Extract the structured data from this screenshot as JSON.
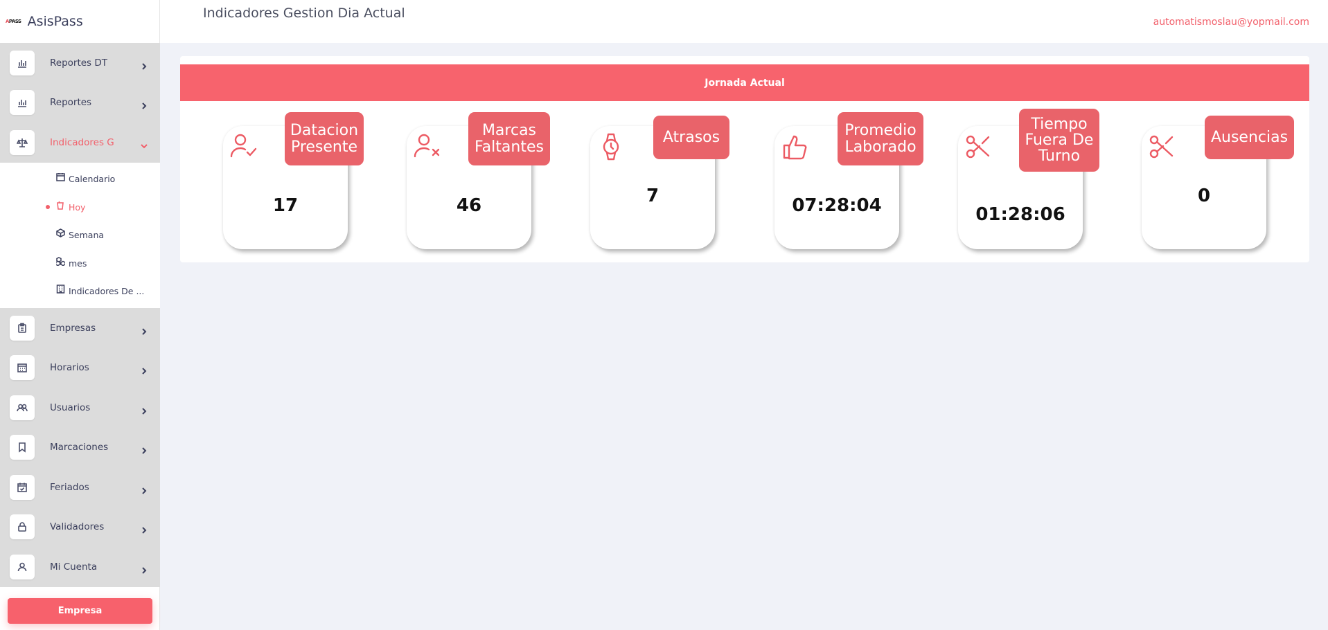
{
  "brand": {
    "logo_text": "AsisPass",
    "name": "AsisPass"
  },
  "header": {
    "title": "Indicadores Gestion Dia Actual",
    "user_email": "automatismoslau@yopmail.com"
  },
  "sidebar": {
    "items_top": [
      {
        "label": "Reportes DT",
        "icon": "bar-chart-icon"
      },
      {
        "label": "Reportes",
        "icon": "bar-chart-icon"
      },
      {
        "label": "Indicadores G",
        "icon": "scale-icon",
        "active": true
      }
    ],
    "submenu": [
      {
        "label": "Calendario",
        "icon": "calendar-icon"
      },
      {
        "label": "Hoy",
        "icon": "cup-icon",
        "active": true
      },
      {
        "label": "Semana",
        "icon": "box-icon"
      },
      {
        "label": "mes",
        "icon": "boxes-icon"
      },
      {
        "label": "Indicadores De ...",
        "icon": "building-icon"
      }
    ],
    "items_bottom": [
      {
        "label": "Empresas",
        "icon": "clipboard-icon"
      },
      {
        "label": "Horarios",
        "icon": "calendar-grid-icon"
      },
      {
        "label": "Usuarios",
        "icon": "users-icon"
      },
      {
        "label": "Marcaciones",
        "icon": "bookmark-icon"
      },
      {
        "label": "Feriados",
        "icon": "calendar-check-icon"
      },
      {
        "label": "Validadores",
        "icon": "lock-icon"
      },
      {
        "label": "Mi Cuenta",
        "icon": "user-icon"
      }
    ],
    "empresa_button": "Empresa"
  },
  "panel": {
    "title": "Jornada Actual",
    "kpis": [
      {
        "label": "Datacion Presente",
        "value": "17",
        "icon": "user-check-icon"
      },
      {
        "label": "Marcas Faltantes",
        "value": "46",
        "icon": "user-x-icon"
      },
      {
        "label": "Atrasos",
        "value": "7",
        "icon": "watch-icon"
      },
      {
        "label": "Promedio Laborado",
        "value": "07:28:04",
        "icon": "thumbs-up-icon"
      },
      {
        "label": "Tiempo Fuera De Turno",
        "value": "01:28:06",
        "icon": "scissors-icon"
      },
      {
        "label": "Ausencias",
        "value": "0",
        "icon": "scissors-icon"
      }
    ]
  },
  "colors": {
    "accent": "#f7636d",
    "label_bg": "#e9636a",
    "sidebar_item_bg": "#dcdcdc"
  }
}
